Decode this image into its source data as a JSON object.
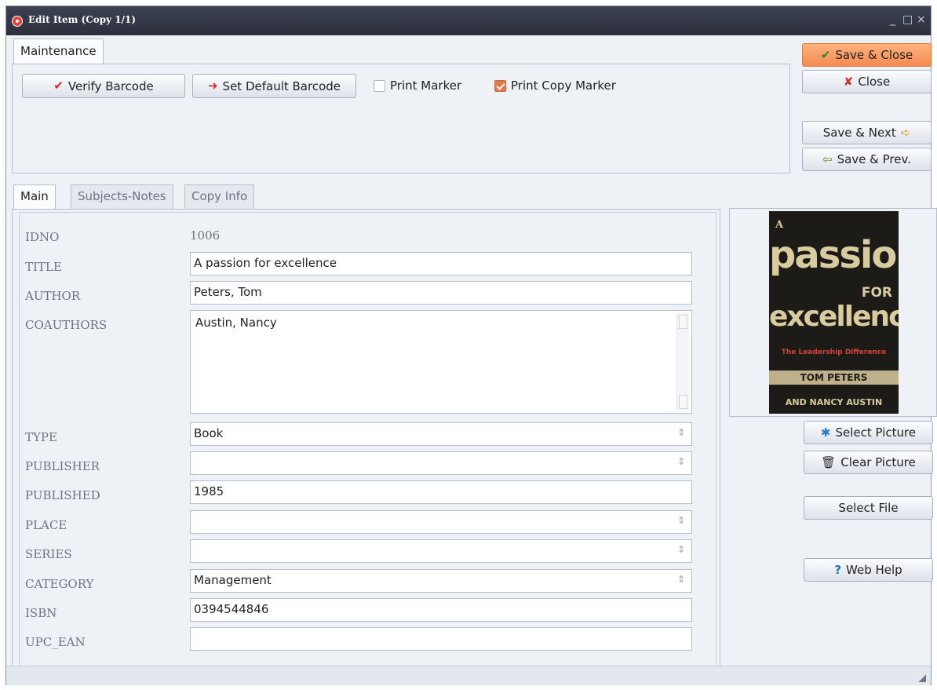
{
  "window": {
    "title": "Edit Item (Copy 1/1)",
    "controls": [
      "_",
      "□",
      "×"
    ]
  },
  "maintenance": {
    "tab_label": "Maintenance",
    "verify_barcode": "Verify Barcode",
    "set_default_barcode": "Set Default Barcode",
    "print_marker": {
      "label": "Print Marker",
      "checked": false
    },
    "print_copy_marker": {
      "label": "Print Copy Marker",
      "checked": true
    }
  },
  "actions": {
    "save_close": "Save & Close",
    "close": "Close",
    "save_next": "Save & Next",
    "save_prev": "Save & Prev."
  },
  "tabs": [
    "Main",
    "Subjects-Notes",
    "Copy Info"
  ],
  "fields": {
    "idno": {
      "label": "IDNO",
      "value": "1006"
    },
    "title": {
      "label": "TITLE",
      "value": "A passion for excellence"
    },
    "author": {
      "label": "AUTHOR",
      "value": "Peters, Tom"
    },
    "coauthors": {
      "label": "COAUTHORS",
      "value": "Austin, Nancy"
    },
    "type": {
      "label": "TYPE",
      "value": "Book"
    },
    "publisher": {
      "label": "PUBLISHER",
      "value": ""
    },
    "published": {
      "label": "PUBLISHED",
      "value": "1985"
    },
    "place": {
      "label": "PLACE",
      "value": ""
    },
    "series": {
      "label": "SERIES",
      "value": ""
    },
    "category": {
      "label": "CATEGORY",
      "value": "Management"
    },
    "isbn": {
      "label": "ISBN",
      "value": "0394544846"
    },
    "upc_ean": {
      "label": "UPC_EAN",
      "value": ""
    }
  },
  "cover": {
    "a": "A",
    "passion": "passion",
    "for": "FOR",
    "excellence": "excellence",
    "subtitle": "The Leadership Difference",
    "author1": "TOM PETERS",
    "author2": "AND NANCY AUSTIN"
  },
  "picture": {
    "select_picture": "Select Picture",
    "clear_picture": "Clear Picture",
    "select_file": "Select File",
    "web_help": "Web Help"
  },
  "colors": {
    "accent": "#f48b52",
    "title_bar": "#2b2f3d",
    "check_red": "#d1302a",
    "help_blue": "#1f6fc2"
  }
}
